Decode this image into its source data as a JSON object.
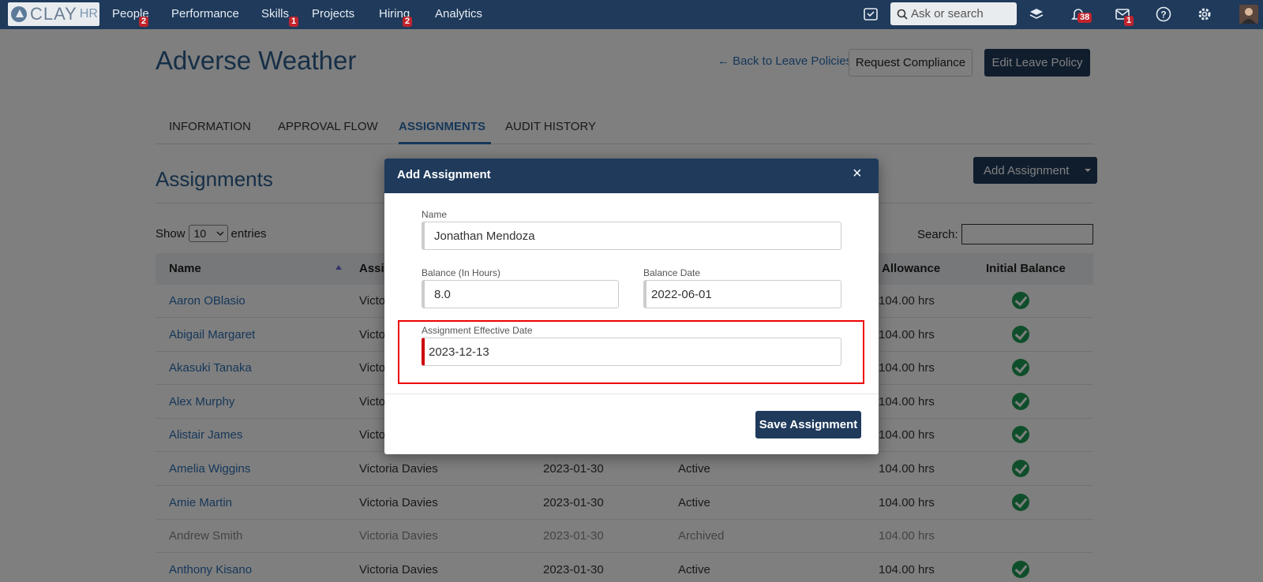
{
  "nav": {
    "logo_text": "CLAY",
    "logo_hr": "HR",
    "items": [
      {
        "label": "People",
        "badge": "2"
      },
      {
        "label": "Performance",
        "badge": ""
      },
      {
        "label": "Skills",
        "badge": "1"
      },
      {
        "label": "Projects",
        "badge": ""
      },
      {
        "label": "Hiring",
        "badge": "2"
      },
      {
        "label": "Analytics",
        "badge": ""
      }
    ],
    "search_placeholder": "Ask or search",
    "notifications_badge": "38",
    "messages_badge": "1"
  },
  "page": {
    "title": "Adverse Weather",
    "back_link": "← Back to Leave Policies",
    "request_compliance": "Request Compliance",
    "edit_policy": "Edit Leave Policy",
    "tabs": [
      "INFORMATION",
      "APPROVAL FLOW",
      "ASSIGNMENTS",
      "AUDIT HISTORY"
    ],
    "active_tab": "ASSIGNMENTS",
    "section_title": "Assignments",
    "add_assignment": "Add Assignment",
    "show": "Show",
    "entries_value": "10",
    "entries": "entries",
    "search_label": "Search:"
  },
  "table": {
    "headers": {
      "name": "Name",
      "assigned_by": "Assi",
      "allowance": "Allowance",
      "initial_balance": "Initial Balance"
    },
    "rows": [
      {
        "name": "Aaron OBlasio",
        "assigned_by": "Victo",
        "date": "",
        "status": "",
        "allowance": "104.00  hrs",
        "check": true,
        "archived": false
      },
      {
        "name": "Abigail Margaret",
        "assigned_by": "Victo",
        "date": "",
        "status": "",
        "allowance": "104.00  hrs",
        "check": true,
        "archived": false
      },
      {
        "name": "Akasuki Tanaka",
        "assigned_by": "Victo",
        "date": "",
        "status": "",
        "allowance": "104.00  hrs",
        "check": true,
        "archived": false
      },
      {
        "name": "Alex Murphy",
        "assigned_by": "Victo",
        "date": "",
        "status": "",
        "allowance": "104.00  hrs",
        "check": true,
        "archived": false
      },
      {
        "name": "Alistair James",
        "assigned_by": "Victo",
        "date": "",
        "status": "",
        "allowance": "104.00  hrs",
        "check": true,
        "archived": false
      },
      {
        "name": "Amelia Wiggins",
        "assigned_by": "Victoria Davies",
        "date": "2023-01-30",
        "status": "Active",
        "allowance": "104.00  hrs",
        "check": true,
        "archived": false
      },
      {
        "name": "Amie Martin",
        "assigned_by": "Victoria Davies",
        "date": "2023-01-30",
        "status": "Active",
        "allowance": "104.00  hrs",
        "check": true,
        "archived": false
      },
      {
        "name": "Andrew Smith",
        "assigned_by": "Victoria Davies",
        "date": "2023-01-30",
        "status": "Archived",
        "allowance": "104.00  hrs",
        "check": false,
        "archived": true
      },
      {
        "name": "Anthony Kisano",
        "assigned_by": "Victoria Davies",
        "date": "2023-01-30",
        "status": "Active",
        "allowance": "104.00  hrs",
        "check": true,
        "archived": false
      }
    ]
  },
  "modal": {
    "title": "Add Assignment",
    "close": "×",
    "name_label": "Name",
    "name_value": "Jonathan Mendoza",
    "balance_label": "Balance (In Hours)",
    "balance_value": "8.0",
    "balance_date_label": "Balance Date",
    "balance_date_value": "2022-06-01",
    "effective_label": "Assignment Effective Date",
    "effective_value": "2023-12-13",
    "save": "Save Assignment"
  },
  "colors": {
    "nav": "#1f3a5b",
    "accent": "#2c6fb3",
    "highlight": "#e00000",
    "check": "#1f9d55"
  }
}
